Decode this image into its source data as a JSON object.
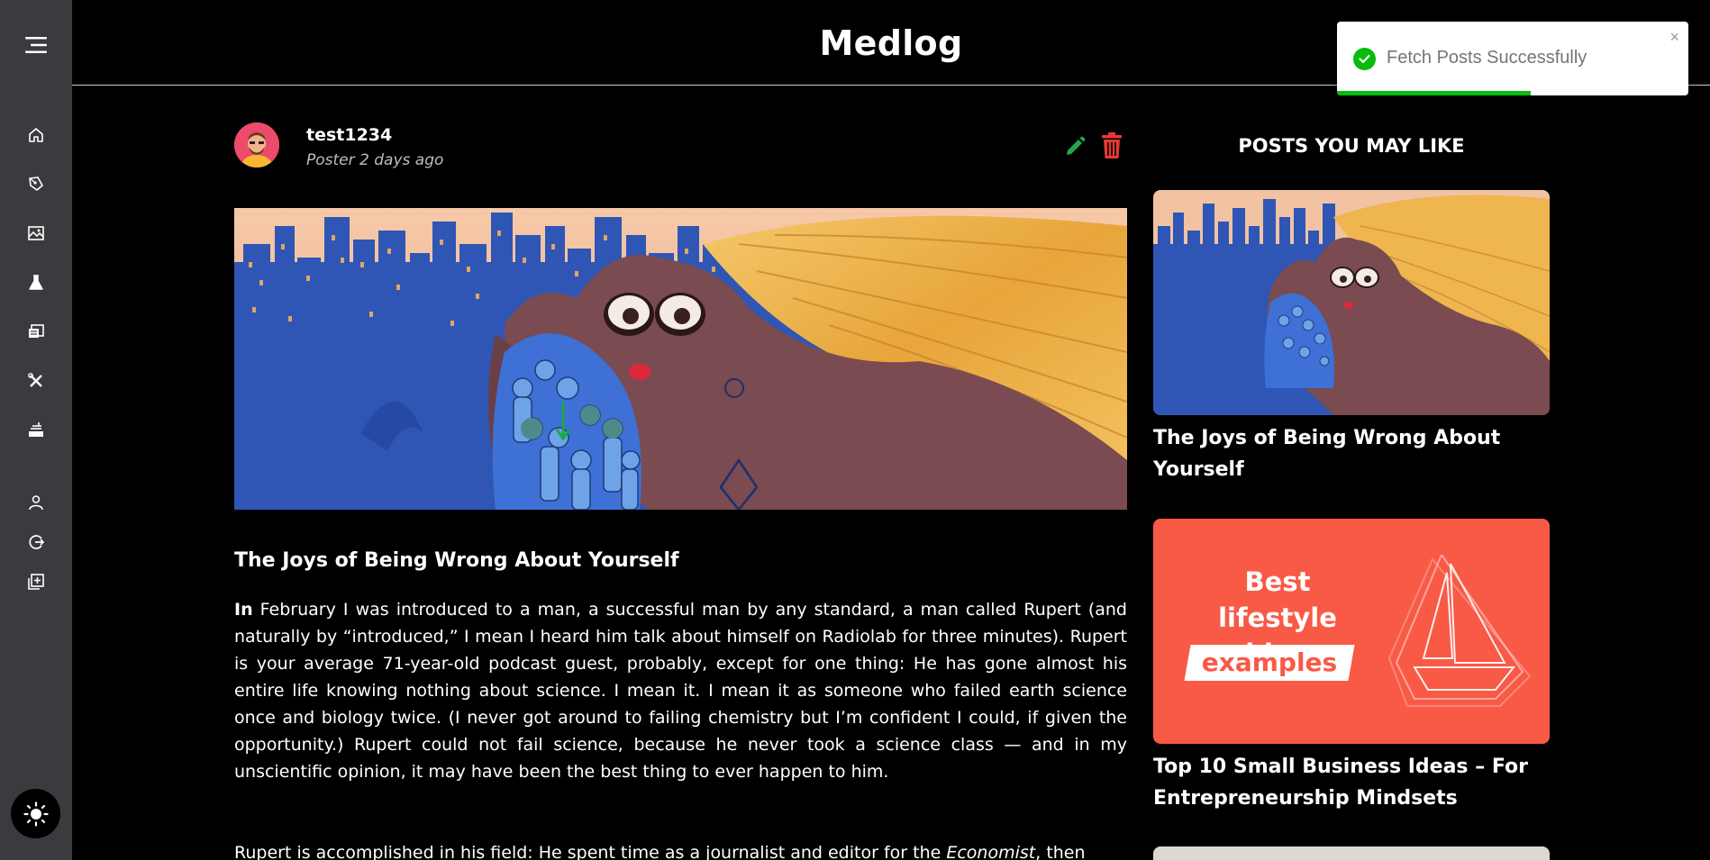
{
  "app": {
    "title": "Medlog"
  },
  "sidebar": {
    "menu_icon": "hamburger-menu-icon",
    "items": [
      {
        "name": "home",
        "icon": "home-icon"
      },
      {
        "name": "write",
        "icon": "pen-nib-icon"
      },
      {
        "name": "gallery",
        "icon": "image-icon"
      },
      {
        "name": "science",
        "icon": "flask-icon"
      },
      {
        "name": "news",
        "icon": "newspaper-icon"
      },
      {
        "name": "tools",
        "icon": "tools-icon"
      },
      {
        "name": "food",
        "icon": "food-icon"
      },
      {
        "name": "profile",
        "icon": "user-icon"
      },
      {
        "name": "logout",
        "icon": "logout-icon"
      },
      {
        "name": "add-post",
        "icon": "add-post-icon"
      }
    ],
    "theme_toggle_icon": "sun-icon"
  },
  "toast": {
    "message": "Fetch Posts Successfully",
    "close": "×",
    "progress": 0.55,
    "color": "#07bc0c"
  },
  "post": {
    "author": "test1234",
    "meta": "Poster 2 days ago",
    "title": "The Joys of Being Wrong About Yourself",
    "lead": "In",
    "body": " February I was introduced to a man, a successful man by any standard, a man called Rupert (and naturally by “introduced,” I mean I heard him talk about himself on Radiolab for three minutes). Rupert is your average 71-year-old podcast guest, probably, except for one thing: He has gone almost his entire life knowing nothing about science. I mean it. I mean it as someone who failed earth science once and biology twice. (I never got around to failing chemistry but I’m confident I could, if given the opportunity.) Rupert could not fail science, because he never took a science class — and in my unscientific opinion, it may have been the best thing to ever happen to him.",
    "body2_pre": "Rupert is accomplished in his field: He spent time as a journalist and editor for the ",
    "body2_em": "Economist",
    "body2_post": ", then",
    "edit_color": "#21a84a",
    "delete_color": "#e53935"
  },
  "side": {
    "heading": "POSTS YOU MAY LIKE",
    "cards": [
      {
        "title": "The Joys of Being Wrong About Yourself"
      },
      {
        "title": "Top 10 Small Business Ideas – For Entrepreneurship Mindsets",
        "image_text": {
          "line1": "Best",
          "line2": "lifestyle blog",
          "line3": "examples"
        },
        "bg": "#f85a46"
      }
    ]
  }
}
